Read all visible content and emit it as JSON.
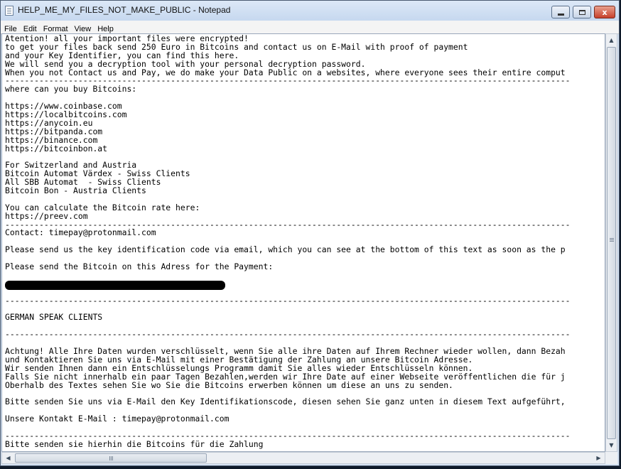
{
  "window": {
    "title": "HELP_ME_MY_FILES_NOT_MAKE_PUBLIC - Notepad"
  },
  "controls": {
    "close_glyph": "x"
  },
  "menu": [
    "File",
    "Edit",
    "Format",
    "View",
    "Help"
  ],
  "document": {
    "lines": [
      "Atention! all your important files were encrypted!",
      "to get your files back send 250 Euro in Bitcoins and contact us on E-Mail with proof of payment",
      "and your Key Identifier, you can find this here.",
      "We will send you a decryption tool with your personal decryption password.",
      "When you not Contact us and Pay, we do make your Data Public on a websites, where everyone sees their entire comput",
      "--------------------------------------------------------------------------------------------------------------------",
      "where can you buy Bitcoins:",
      "",
      "https://www.coinbase.com",
      "https://localbitcoins.com",
      "https://anycoin.eu",
      "https://bitpanda.com",
      "https://binance.com",
      "https://bitcoinbon.at",
      "",
      "For Switzerland and Austria",
      "Bitcoin Automat Värdex - Swiss Clients",
      "All SBB Automat  - Swiss Clients",
      "Bitcoin Bon - Austria Clients",
      "",
      "You can calculate the Bitcoin rate here:",
      "https://preev.com",
      "--------------------------------------------------------------------------------------------------------------------",
      "Contact: timepay@protonmail.com",
      "",
      "Please send us the key identification code via email, which you can see at the bottom of this text as soon as the p",
      "",
      "Please send the Bitcoin on this Adress for the Payment:",
      "",
      "",
      "",
      "--------------------------------------------------------------------------------------------------------------------",
      "",
      "GERMAN SPEAK CLIENTS",
      "",
      "--------------------------------------------------------------------------------------------------------------------",
      "",
      "Achtung! Alle Ihre Daten wurden verschlüsselt, wenn Sie alle ihre Daten auf Ihrem Rechner wieder wollen, dann Bezah",
      "und Kontaktieren Sie uns via E-Mail mit einer Bestätigung der Zahlung an unsere Bitcoin Adresse.",
      "Wir senden Ihnen dann ein Entschlüsselungs Programm damit Sie alles wieder Entschlüsseln können.",
      "Falls Sie nicht innerhalb ein paar Tagen Bezahlen,werden wir Ihre Date auf einer Webseite veröffentlichen die für j",
      "Oberhalb des Textes sehen Sie wo Sie die Bitcoins erwerben können um diese an uns zu senden.",
      "",
      "Bitte senden Sie uns via E-Mail den Key Identifikationscode, diesen sehen Sie ganz unten in diesem Text aufgeführt,",
      "",
      "Unsere Kontakt E-Mail : timepay@protonmail.com",
      "",
      "--------------------------------------------------------------------------------------------------------------------",
      "Bitte senden sie hierhin die Bitcoins für die Zahlung"
    ]
  }
}
